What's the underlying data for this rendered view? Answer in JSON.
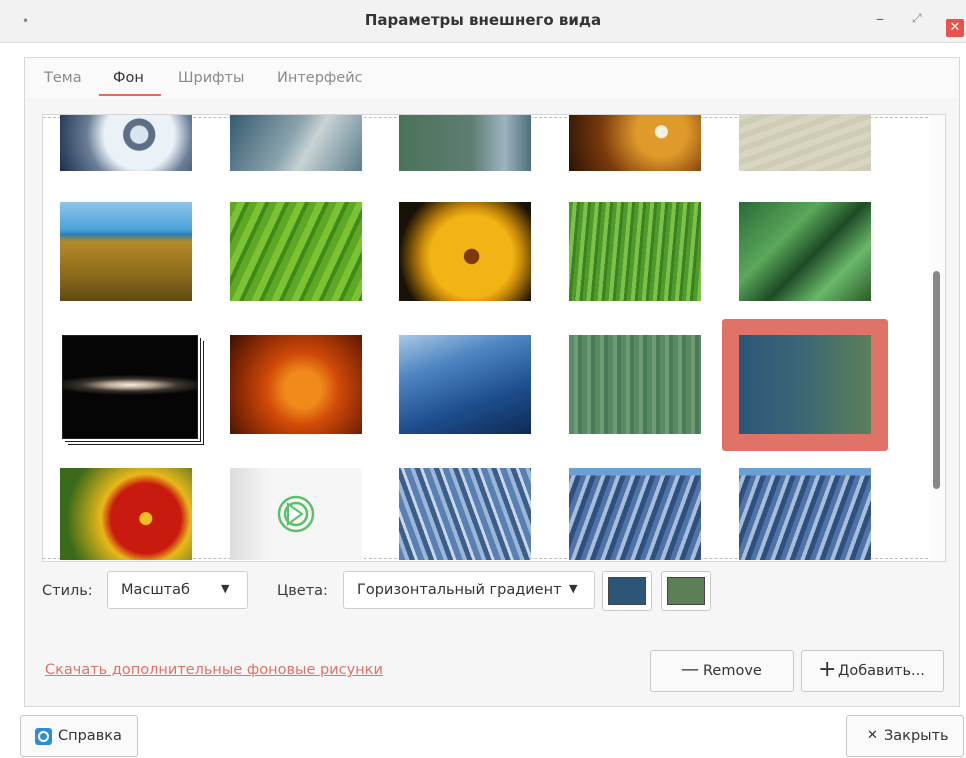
{
  "window": {
    "title": "Параметры внешнего вида",
    "min_glyph": "–",
    "max_glyph": "⤢",
    "close_glyph": "✕",
    "menu_glyph": "•"
  },
  "tabs": [
    {
      "label": "Тема",
      "active": false
    },
    {
      "label": "Фон",
      "active": true
    },
    {
      "label": "Шрифты",
      "active": false
    },
    {
      "label": "Интерфейс",
      "active": false
    }
  ],
  "wallpapers": [
    {
      "name": "water-drop",
      "selected": false
    },
    {
      "name": "grey-teal-swirl",
      "selected": false
    },
    {
      "name": "green-teal-abstract",
      "selected": false
    },
    {
      "name": "dandelion-orange",
      "selected": false
    },
    {
      "name": "sand-texture",
      "selected": false
    },
    {
      "name": "grass-sea",
      "selected": false
    },
    {
      "name": "green-leaf-macro",
      "selected": false
    },
    {
      "name": "yellow-flower",
      "selected": false
    },
    {
      "name": "green-grass",
      "selected": false
    },
    {
      "name": "green-leaves-dew",
      "selected": false
    },
    {
      "name": "sombrero-galaxy",
      "selected": false
    },
    {
      "name": "orange-flower",
      "selected": false
    },
    {
      "name": "blue-waves",
      "selected": false
    },
    {
      "name": "green-stripes",
      "selected": false
    },
    {
      "name": "horizontal-gradient",
      "selected": true
    },
    {
      "name": "red-marigold",
      "selected": false
    },
    {
      "name": "green-logo-white",
      "selected": false
    },
    {
      "name": "blue-flowers-painting",
      "selected": false
    },
    {
      "name": "blue-mosaic-1",
      "selected": false
    },
    {
      "name": "blue-mosaic-2",
      "selected": false
    }
  ],
  "controls": {
    "style_label": "Стиль:",
    "style_value": "Масштаб",
    "colors_label": "Цвета:",
    "colors_value": "Горизонтальный градиент",
    "color1": "#2c5678",
    "color2": "#5c7f58",
    "dropdown_arrow": "▼"
  },
  "download_link": "Скачать дополнительные фоновые рисунки",
  "buttons": {
    "remove": "Remove",
    "remove_icon": "—",
    "add": "Добавить...",
    "add_icon": "+",
    "help": "Справка",
    "close": "Закрыть",
    "close_icon": "✕"
  },
  "colors": {
    "accent": "#e56a63",
    "selection": "#e07368",
    "link": "#e07368"
  }
}
